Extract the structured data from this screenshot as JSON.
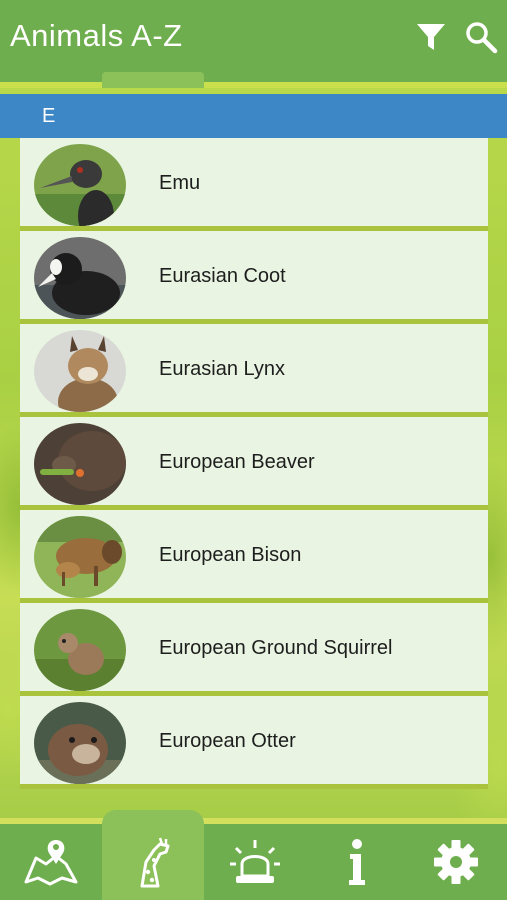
{
  "header": {
    "title": "Animals A-Z",
    "icons": [
      "filter-icon",
      "search-icon"
    ]
  },
  "section": {
    "letter": "E"
  },
  "animals": [
    {
      "name": "Emu",
      "icon": "emu-photo"
    },
    {
      "name": "Eurasian Coot",
      "icon": "coot-photo"
    },
    {
      "name": "Eurasian Lynx",
      "icon": "lynx-photo"
    },
    {
      "name": "European Beaver",
      "icon": "beaver-photo"
    },
    {
      "name": "European Bison",
      "icon": "bison-photo"
    },
    {
      "name": "European Ground Squirrel",
      "icon": "squirrel-photo"
    },
    {
      "name": "European Otter",
      "icon": "otter-photo"
    }
  ],
  "tabbar": {
    "tabs": [
      {
        "icon": "map-icon",
        "active": false
      },
      {
        "icon": "giraffe-icon",
        "active": true
      },
      {
        "icon": "alert-siren-icon",
        "active": false
      },
      {
        "icon": "info-icon",
        "active": false
      },
      {
        "icon": "gear-icon",
        "active": false
      }
    ]
  },
  "colors": {
    "header": "#6fae4e",
    "section": "#3d87c6",
    "row": "#e9f5e2",
    "accent": "#c9e04c"
  }
}
